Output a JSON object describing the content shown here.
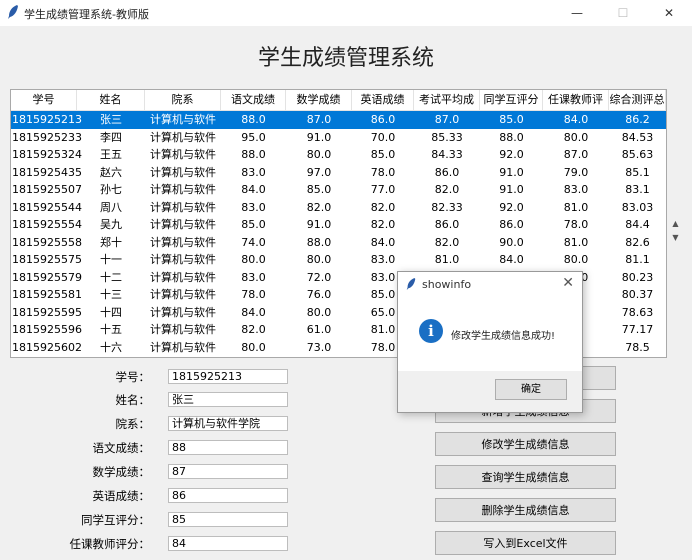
{
  "window": {
    "title": "学生成绩管理系统-教师版",
    "icon": "feather-icon",
    "controls": {
      "minimize": "—",
      "maximize": "☐",
      "close": "✕"
    }
  },
  "app": {
    "heading": "学生成绩管理系统"
  },
  "table": {
    "columns": [
      "学号",
      "姓名",
      "院系",
      "语文成绩",
      "数学成绩",
      "英语成绩",
      "考试平均成绩",
      "同学互评分",
      "任课教师评分",
      "综合测评总分"
    ],
    "selected_index": 0,
    "rows": [
      [
        "1815925213",
        "张三",
        "计算机与软件",
        "88.0",
        "87.0",
        "86.0",
        "87.0",
        "85.0",
        "84.0",
        "86.2"
      ],
      [
        "1815925233",
        "李四",
        "计算机与软件",
        "95.0",
        "91.0",
        "70.0",
        "85.33",
        "88.0",
        "80.0",
        "84.53"
      ],
      [
        "1815925324",
        "王五",
        "计算机与软件",
        "88.0",
        "80.0",
        "85.0",
        "84.33",
        "92.0",
        "87.0",
        "85.63"
      ],
      [
        "1815925435",
        "赵六",
        "计算机与软件",
        "83.0",
        "97.0",
        "78.0",
        "86.0",
        "91.0",
        "79.0",
        "85.1"
      ],
      [
        "1815925507",
        "孙七",
        "计算机与软件",
        "84.0",
        "85.0",
        "77.0",
        "82.0",
        "91.0",
        "83.0",
        "83.1"
      ],
      [
        "1815925544",
        "周八",
        "计算机与软件",
        "83.0",
        "82.0",
        "82.0",
        "82.33",
        "92.0",
        "81.0",
        "83.03"
      ],
      [
        "1815925554",
        "吴九",
        "计算机与软件",
        "85.0",
        "91.0",
        "82.0",
        "86.0",
        "86.0",
        "78.0",
        "84.4"
      ],
      [
        "1815925558",
        "郑十",
        "计算机与软件",
        "74.0",
        "88.0",
        "84.0",
        "82.0",
        "90.0",
        "81.0",
        "82.6"
      ],
      [
        "1815925575",
        "十一",
        "计算机与软件",
        "80.0",
        "80.0",
        "83.0",
        "81.0",
        "84.0",
        "80.0",
        "81.1"
      ],
      [
        "1815925579",
        "十二",
        "计算机与软件",
        "83.0",
        "72.0",
        "83.0",
        "79.33",
        "91.0",
        "78.0",
        "80.23"
      ],
      [
        "1815925581",
        "十三",
        "计算机与软件",
        "78.0",
        "76.0",
        "85.0",
        "",
        "",
        "",
        "80.37"
      ],
      [
        "1815925595",
        "十四",
        "计算机与软件",
        "84.0",
        "80.0",
        "65.0",
        "",
        "",
        "",
        "78.63"
      ],
      [
        "1815925596",
        "十五",
        "计算机与软件",
        "82.0",
        "61.0",
        "81.0",
        "",
        "",
        "",
        "77.17"
      ],
      [
        "1815925602",
        "十六",
        "计算机与软件",
        "80.0",
        "73.0",
        "78.0",
        "",
        "",
        "",
        "78.5"
      ],
      [
        "1815925607",
        "十七",
        "计算机与软件",
        "77.0",
        "82.0",
        "78.0",
        "",
        "",
        "",
        "79.8"
      ]
    ]
  },
  "form": {
    "fields": [
      {
        "label": "学号：",
        "value": "1815925213"
      },
      {
        "label": "姓名：",
        "value": "张三"
      },
      {
        "label": "院系：",
        "value": "计算机与软件学院"
      },
      {
        "label": "语文成绩：",
        "value": "88"
      },
      {
        "label": "数学成绩：",
        "value": "87"
      },
      {
        "label": "英语成绩：",
        "value": "86"
      },
      {
        "label": "同学互评分：",
        "value": "85"
      },
      {
        "label": "任课教师评分：",
        "value": "84"
      }
    ]
  },
  "buttons": {
    "add": "新增学生成绩信息",
    "modify": "修改学生成绩信息",
    "query": "查询学生成绩信息",
    "delete": "删除学生成绩信息",
    "export": "写入到Excel文件"
  },
  "dialog": {
    "title": "showinfo",
    "message": "修改学生成绩信息成功!",
    "ok_label": "确定",
    "icon": "info-icon",
    "icon_glyph": "i"
  },
  "colors": {
    "selection": "#0078d7",
    "info": "#1a6fc4"
  }
}
